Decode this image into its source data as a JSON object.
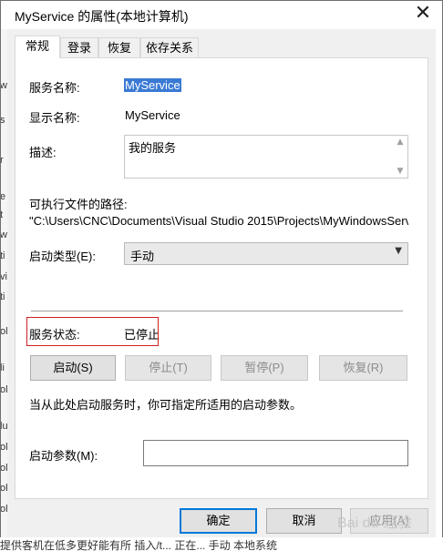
{
  "window": {
    "title": "MyService 的属性(本地计算机)",
    "close_glyph": "✕"
  },
  "tabs": [
    {
      "label": "常规",
      "active": true
    },
    {
      "label": "登录",
      "active": false
    },
    {
      "label": "恢复",
      "active": false
    },
    {
      "label": "依存关系",
      "active": false
    }
  ],
  "general": {
    "service_name_label": "服务名称:",
    "service_name_value": "MyService",
    "display_name_label": "显示名称:",
    "display_name_value": "MyService",
    "description_label": "描述:",
    "description_value": "我的服务",
    "exe_path_label": "可执行文件的路径:",
    "exe_path_value": "\"C:\\Users\\CNC\\Documents\\Visual Studio 2015\\Projects\\MyWindowsServ",
    "startup_type_label": "启动类型(E):",
    "startup_type_value": "手动",
    "status_label": "服务状态:",
    "status_value": "已停止",
    "hint_text": "当从此处启动服务时，你可指定所适用的启动参数。",
    "start_params_label": "启动参数(M):",
    "start_params_value": ""
  },
  "control_buttons": {
    "start": "启动(S)",
    "stop": "停止(T)",
    "pause": "暂停(P)",
    "resume": "恢复(R)"
  },
  "dialog_buttons": {
    "ok": "确定",
    "cancel": "取消",
    "apply": "应用(A)"
  },
  "watermark": "Bai du 经验",
  "background_fragments": {
    "left": [
      "w",
      "s",
      "r",
      "e",
      "t",
      "w",
      "ti",
      "vi",
      "ti",
      "ol",
      "li",
      "ol",
      "lu",
      "ol",
      "ol",
      "ol",
      "ol"
    ],
    "bottom": "提供客机在低多更好能有所 插入/t... 正在... 手动 本地系统"
  },
  "colors": {
    "selection": "#3a7ad5",
    "status_highlight": "#d02020",
    "default_button_border": "#0078d7"
  },
  "icons": {
    "close": "close-icon",
    "scroll_up": "arrow-up-icon",
    "scroll_down": "arrow-down-icon",
    "dropdown": "chevron-down-icon"
  }
}
